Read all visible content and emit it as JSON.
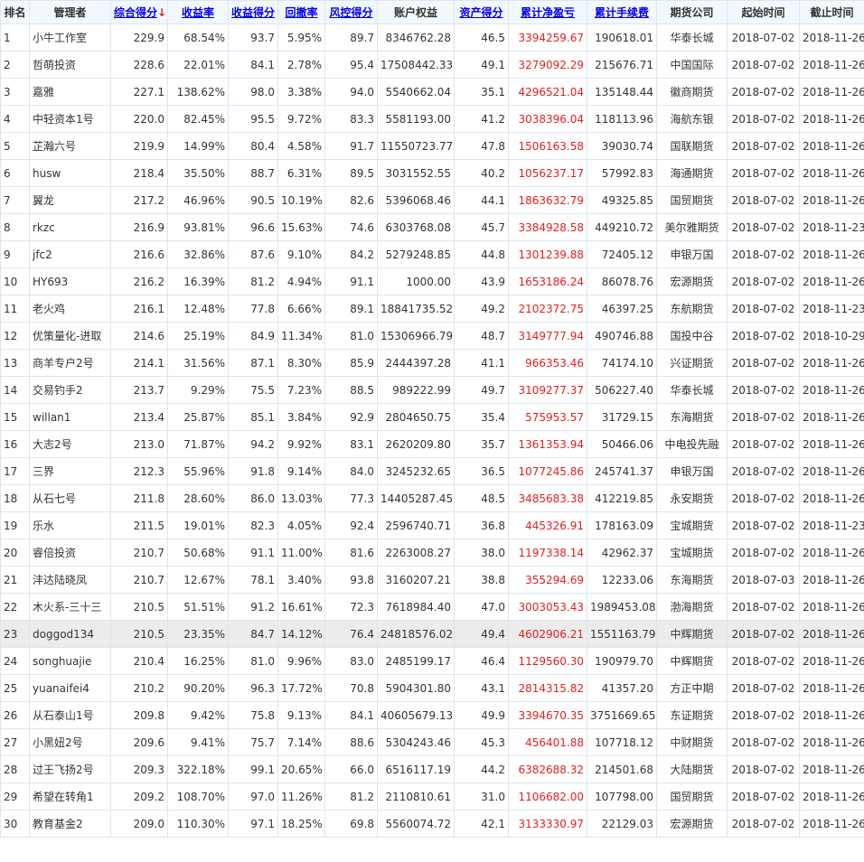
{
  "columns": [
    {
      "key": "rank",
      "label": "排名",
      "sortable": false
    },
    {
      "key": "manager",
      "label": "管理者",
      "sortable": false
    },
    {
      "key": "total_score",
      "label": "综合得分",
      "sortable": true,
      "sorted": true,
      "arrow": "↓"
    },
    {
      "key": "return_rate",
      "label": "收益率",
      "sortable": true
    },
    {
      "key": "return_score",
      "label": "收益得分",
      "sortable": true
    },
    {
      "key": "drawdown",
      "label": "回撤率",
      "sortable": true
    },
    {
      "key": "risk_score",
      "label": "风控得分",
      "sortable": true
    },
    {
      "key": "equity",
      "label": "账户权益",
      "sortable": false
    },
    {
      "key": "asset_score",
      "label": "资产得分",
      "sortable": true
    },
    {
      "key": "net_profit",
      "label": "累计净盈亏",
      "sortable": true
    },
    {
      "key": "fees",
      "label": "累计手续费",
      "sortable": true
    },
    {
      "key": "broker",
      "label": "期货公司",
      "sortable": false
    },
    {
      "key": "start",
      "label": "起始时间",
      "sortable": false
    },
    {
      "key": "end",
      "label": "截止时间",
      "sortable": false
    }
  ],
  "colors": {
    "profit": "#e02020",
    "link": "#0000ee",
    "highlight_row": "#ececec",
    "header_bg": "#f2f8fc",
    "border": "#d9e6f2"
  },
  "highlighted_rank": "23",
  "rows": [
    [
      "1",
      "小牛工作室",
      "229.9",
      "68.54%",
      "93.7",
      "5.95%",
      "89.7",
      "8346762.28",
      "46.5",
      "3394259.67",
      "190618.01",
      "华泰长城",
      "2018-07-02",
      "2018-11-26"
    ],
    [
      "2",
      "哲萌投资",
      "228.6",
      "22.01%",
      "84.1",
      "2.78%",
      "95.4",
      "17508442.33",
      "49.1",
      "3279092.29",
      "215676.71",
      "中国国际",
      "2018-07-02",
      "2018-11-26"
    ],
    [
      "3",
      "嘉雅",
      "227.1",
      "138.62%",
      "98.0",
      "3.38%",
      "94.0",
      "5540662.04",
      "35.1",
      "4296521.04",
      "135148.44",
      "徽商期货",
      "2018-07-02",
      "2018-11-26"
    ],
    [
      "4",
      "中轻资本1号",
      "220.0",
      "82.45%",
      "95.5",
      "9.72%",
      "83.3",
      "5581193.00",
      "41.2",
      "3038396.04",
      "118113.96",
      "海航东银",
      "2018-07-02",
      "2018-11-26"
    ],
    [
      "5",
      "芷瀚六号",
      "219.9",
      "14.99%",
      "80.4",
      "4.58%",
      "91.7",
      "11550723.77",
      "47.8",
      "1506163.58",
      "39030.74",
      "国联期货",
      "2018-07-02",
      "2018-11-26"
    ],
    [
      "6",
      "husw",
      "218.4",
      "35.50%",
      "88.7",
      "6.31%",
      "89.5",
      "3031552.55",
      "40.2",
      "1056237.17",
      "57992.83",
      "海通期货",
      "2018-07-02",
      "2018-11-26"
    ],
    [
      "7",
      "翼龙",
      "217.2",
      "46.96%",
      "90.5",
      "10.19%",
      "82.6",
      "5396068.46",
      "44.1",
      "1863632.79",
      "49325.85",
      "国贸期货",
      "2018-07-02",
      "2018-11-26"
    ],
    [
      "8",
      "rkzc",
      "216.9",
      "93.81%",
      "96.6",
      "15.63%",
      "74.6",
      "6303768.08",
      "45.7",
      "3384928.58",
      "449210.72",
      "美尔雅期货",
      "2018-07-02",
      "2018-11-23"
    ],
    [
      "9",
      "jfc2",
      "216.6",
      "32.86%",
      "87.6",
      "9.10%",
      "84.2",
      "5279248.85",
      "44.8",
      "1301239.88",
      "72405.12",
      "申银万国",
      "2018-07-02",
      "2018-11-26"
    ],
    [
      "10",
      "HY693",
      "216.2",
      "16.39%",
      "81.2",
      "4.94%",
      "91.1",
      "1000.00",
      "43.9",
      "1653186.24",
      "86078.76",
      "宏源期货",
      "2018-07-02",
      "2018-11-26"
    ],
    [
      "11",
      "老火鸡",
      "216.1",
      "12.48%",
      "77.8",
      "6.66%",
      "89.1",
      "18841735.52",
      "49.2",
      "2102372.75",
      "46397.25",
      "东航期货",
      "2018-07-02",
      "2018-11-23"
    ],
    [
      "12",
      "优策量化-进取",
      "214.6",
      "25.19%",
      "84.9",
      "11.34%",
      "81.0",
      "15306966.79",
      "48.7",
      "3149777.94",
      "490746.88",
      "国投中谷",
      "2018-07-02",
      "2018-10-29"
    ],
    [
      "13",
      "商羊专户2号",
      "214.1",
      "31.56%",
      "87.1",
      "8.30%",
      "85.9",
      "2444397.28",
      "41.1",
      "966353.46",
      "74174.10",
      "兴证期货",
      "2018-07-02",
      "2018-11-26"
    ],
    [
      "14",
      "交易钓手2",
      "213.7",
      "9.29%",
      "75.5",
      "7.23%",
      "88.5",
      "989222.99",
      "49.7",
      "3109277.37",
      "506227.40",
      "华泰长城",
      "2018-07-02",
      "2018-11-26"
    ],
    [
      "15",
      "willan1",
      "213.4",
      "25.87%",
      "85.1",
      "3.84%",
      "92.9",
      "2804650.75",
      "35.4",
      "575953.57",
      "31729.15",
      "东海期货",
      "2018-07-02",
      "2018-11-26"
    ],
    [
      "16",
      "大志2号",
      "213.0",
      "71.87%",
      "94.2",
      "9.92%",
      "83.1",
      "2620209.80",
      "35.7",
      "1361353.94",
      "50466.06",
      "中电投先融",
      "2018-07-02",
      "2018-11-26"
    ],
    [
      "17",
      "三界",
      "212.3",
      "55.96%",
      "91.8",
      "9.14%",
      "84.0",
      "3245232.65",
      "36.5",
      "1077245.86",
      "245741.37",
      "申银万国",
      "2018-07-02",
      "2018-11-26"
    ],
    [
      "18",
      "从石七号",
      "211.8",
      "28.60%",
      "86.0",
      "13.03%",
      "77.3",
      "14405287.45",
      "48.5",
      "3485683.38",
      "412219.85",
      "永安期货",
      "2018-07-02",
      "2018-11-26"
    ],
    [
      "19",
      "乐水",
      "211.5",
      "19.01%",
      "82.3",
      "4.05%",
      "92.4",
      "2596740.71",
      "36.8",
      "445326.91",
      "178163.09",
      "宝城期货",
      "2018-07-02",
      "2018-11-23"
    ],
    [
      "20",
      "睿倍投资",
      "210.7",
      "50.68%",
      "91.1",
      "11.00%",
      "81.6",
      "2263008.27",
      "38.0",
      "1197338.14",
      "42962.37",
      "宝城期货",
      "2018-07-02",
      "2018-11-26"
    ],
    [
      "21",
      "沣达陆晓凤",
      "210.7",
      "12.67%",
      "78.1",
      "3.40%",
      "93.8",
      "3160207.21",
      "38.8",
      "355294.69",
      "12233.06",
      "东海期货",
      "2018-07-03",
      "2018-11-26"
    ],
    [
      "22",
      "木火系-三十三",
      "210.5",
      "51.51%",
      "91.2",
      "16.61%",
      "72.3",
      "7618984.40",
      "47.0",
      "3003053.43",
      "1989453.08",
      "渤海期货",
      "2018-07-02",
      "2018-11-26"
    ],
    [
      "23",
      "doggod134",
      "210.5",
      "23.35%",
      "84.7",
      "14.12%",
      "76.4",
      "24818576.02",
      "49.4",
      "4602906.21",
      "1551163.79",
      "中辉期货",
      "2018-07-02",
      "2018-11-26"
    ],
    [
      "24",
      "songhuajie",
      "210.4",
      "16.25%",
      "81.0",
      "9.96%",
      "83.0",
      "2485199.17",
      "46.4",
      "1129560.30",
      "190979.70",
      "中辉期货",
      "2018-07-02",
      "2018-11-26"
    ],
    [
      "25",
      "yuanaifei4",
      "210.2",
      "90.20%",
      "96.3",
      "17.72%",
      "70.8",
      "5904301.80",
      "43.1",
      "2814315.82",
      "41357.20",
      "方正中期",
      "2018-07-02",
      "2018-11-26"
    ],
    [
      "26",
      "从石泰山1号",
      "209.8",
      "9.42%",
      "75.8",
      "9.13%",
      "84.1",
      "40605679.13",
      "49.9",
      "3394670.35",
      "3751669.65",
      "东证期货",
      "2018-07-02",
      "2018-11-26"
    ],
    [
      "27",
      "小黑妞2号",
      "209.6",
      "9.41%",
      "75.7",
      "7.14%",
      "88.6",
      "5304243.46",
      "45.3",
      "456401.88",
      "107718.12",
      "中财期货",
      "2018-07-02",
      "2018-11-26"
    ],
    [
      "28",
      "过王飞扬2号",
      "209.3",
      "322.18%",
      "99.1",
      "20.65%",
      "66.0",
      "6516117.19",
      "44.2",
      "6382688.32",
      "214501.68",
      "大陆期货",
      "2018-07-02",
      "2018-11-26"
    ],
    [
      "29",
      "希望在转角1",
      "209.2",
      "108.70%",
      "97.0",
      "11.26%",
      "81.2",
      "2110810.61",
      "31.0",
      "1106682.00",
      "107798.00",
      "国贸期货",
      "2018-07-02",
      "2018-11-26"
    ],
    [
      "30",
      "教育基金2",
      "209.0",
      "110.30%",
      "97.1",
      "18.25%",
      "69.8",
      "5560074.72",
      "42.1",
      "3133330.97",
      "22129.03",
      "宏源期货",
      "2018-07-02",
      "2018-11-26"
    ]
  ]
}
